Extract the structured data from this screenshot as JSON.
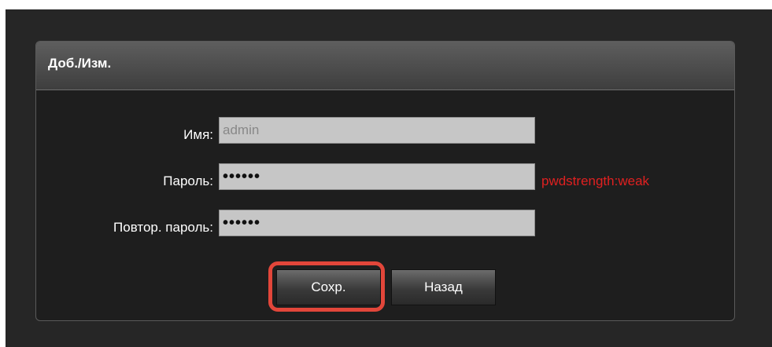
{
  "dialog": {
    "title": "Доб./Изм."
  },
  "form": {
    "name": {
      "label": "Имя:",
      "value": "admin"
    },
    "password": {
      "label": "Пароль:",
      "value": "••••••",
      "strength": "pwdstrength:weak"
    },
    "confirm": {
      "label": "Повтор. пароль:",
      "value": "••••••"
    }
  },
  "buttons": {
    "save": "Сохр.",
    "back": "Назад"
  },
  "colors": {
    "strength_weak": "#e02020",
    "highlight": "#e2463a"
  }
}
